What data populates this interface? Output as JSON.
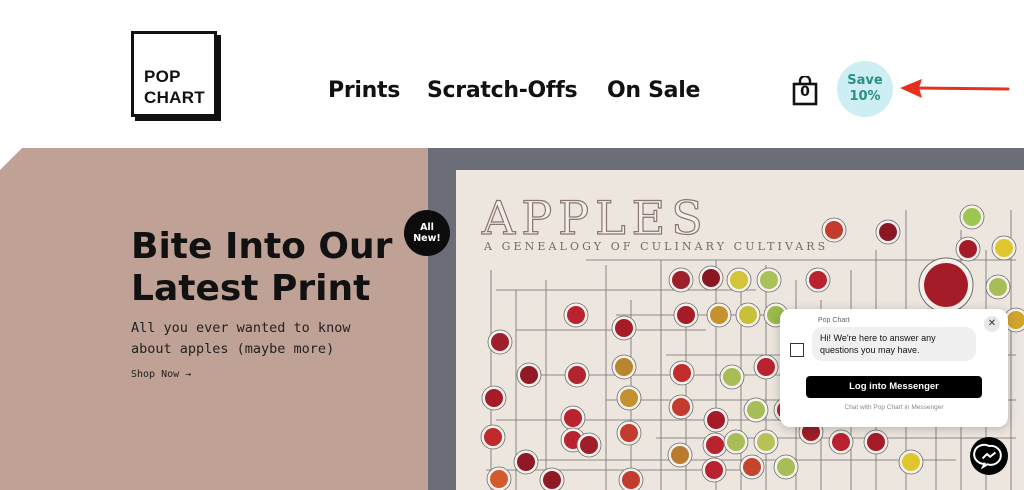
{
  "header": {
    "logo": {
      "line1": "POP",
      "line2": "CHART"
    },
    "nav": [
      {
        "label": "Prints"
      },
      {
        "label": "Scratch-Offs"
      },
      {
        "label": "On Sale"
      }
    ],
    "cart_count": "0",
    "save_badge": {
      "line1": "Save",
      "line2": "10%"
    }
  },
  "hero": {
    "title_line1": "Bite Into Our",
    "title_line2": "Latest Print",
    "subtitle_line1": "All you ever wanted to know",
    "subtitle_line2": "about apples (maybe more)",
    "cta": "Shop Now →",
    "badge_line1": "All",
    "badge_line2": "New!"
  },
  "poster": {
    "title": "APPLES",
    "subtitle": "A GENEALOGY OF CULINARY CULTIVARS"
  },
  "messenger": {
    "brand": "Pop Chart",
    "message": "Hi! We're here to answer any questions you may have.",
    "login_button": "Log into Messenger",
    "footer": "Chat with Pop Chart in Messenger"
  },
  "colors": {
    "hero_bg": "#bfa195",
    "poster_frame": "#6b6e78",
    "poster_bg": "#ece6df",
    "save_badge_bg": "#cdeef2",
    "save_badge_text": "#2b8f86",
    "arrow": "#e8301f"
  },
  "icons": [
    "cart-icon",
    "arrow-icon",
    "close-icon",
    "messenger-icon",
    "chat-avatar-icon"
  ]
}
